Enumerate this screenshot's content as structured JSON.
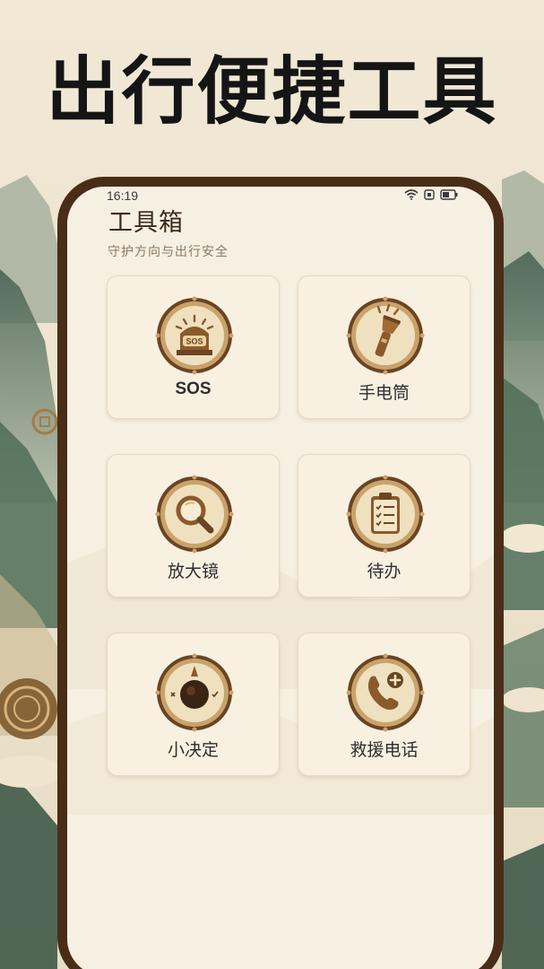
{
  "promo": {
    "headline": "出行便捷工具"
  },
  "status_bar": {
    "time": "16:19"
  },
  "page": {
    "title": "工具箱",
    "subtitle": "守护方向与出行安全"
  },
  "tools": [
    {
      "label": "SOS",
      "icon": "sos-alarm-icon",
      "badge_text": "SOS"
    },
    {
      "label": "手电筒",
      "icon": "flashlight-icon"
    },
    {
      "label": "放大镜",
      "icon": "magnifier-icon"
    },
    {
      "label": "待办",
      "icon": "clipboard-checklist-icon"
    },
    {
      "label": "小决定",
      "icon": "decision-compass-icon"
    },
    {
      "label": "救援电话",
      "icon": "phone-plus-icon"
    }
  ],
  "colors": {
    "frame": "#4a2d17",
    "screen": "#f6f0e3",
    "card": "#f8f1e1",
    "icon_ring": "#c9a36a",
    "icon_inner": "#e9d7b1",
    "icon_dark": "#6b4423",
    "headline": "#151515"
  }
}
